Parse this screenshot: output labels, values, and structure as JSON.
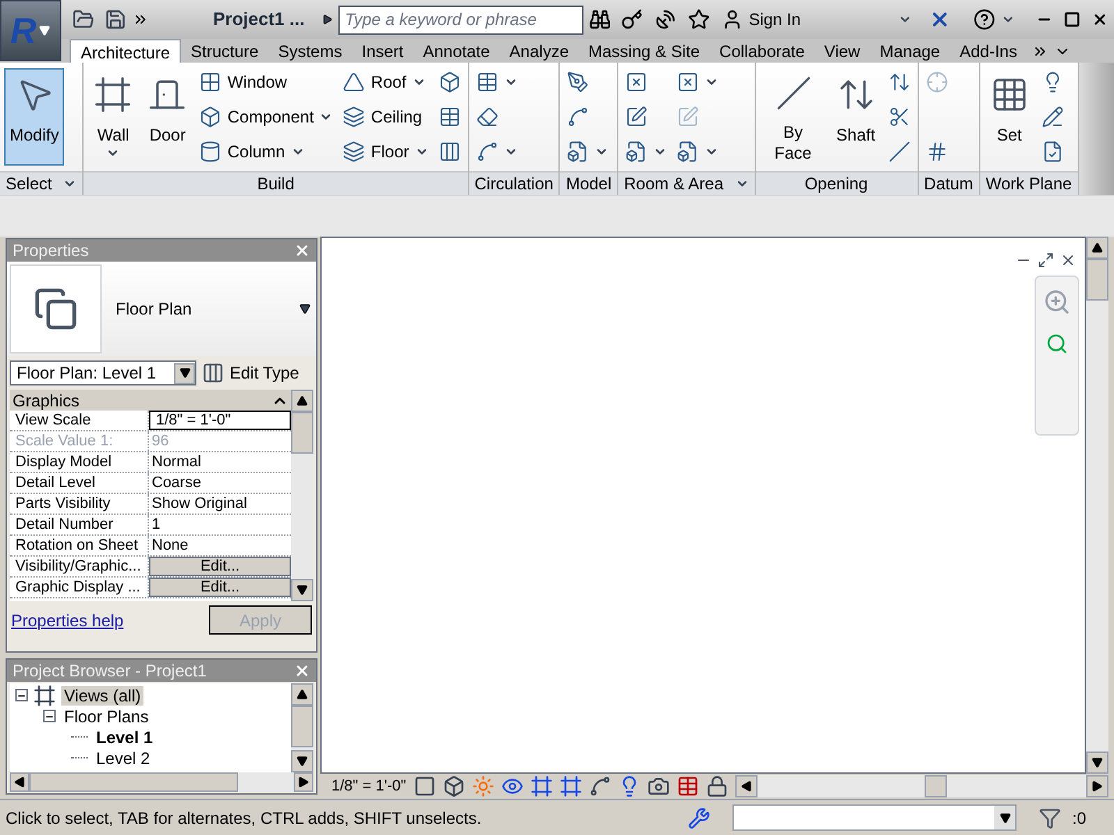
{
  "title_bar": {
    "logo_letter": "R",
    "project_title": "Project1 ...",
    "search": {
      "placeholder": "Type a keyword or phrase"
    },
    "sign_in": "Sign In"
  },
  "tabs": [
    {
      "label": "Architecture",
      "selected": true
    },
    {
      "label": "Structure",
      "selected": false
    },
    {
      "label": "Systems",
      "selected": false
    },
    {
      "label": "Insert",
      "selected": false
    },
    {
      "label": "Annotate",
      "selected": false
    },
    {
      "label": "Analyze",
      "selected": false
    },
    {
      "label": "Massing & Site",
      "selected": false
    },
    {
      "label": "Collaborate",
      "selected": false
    },
    {
      "label": "View",
      "selected": false
    },
    {
      "label": "Manage",
      "selected": false
    },
    {
      "label": "Add-Ins",
      "selected": false
    }
  ],
  "ribbon": [
    {
      "label": "Select",
      "menu": true,
      "columns": [
        {
          "kind": "large",
          "label": "Modify",
          "selected": true,
          "dropdown": false
        }
      ]
    },
    {
      "label": "Build",
      "menu": false,
      "columns": [
        {
          "kind": "large",
          "label": "Wall",
          "selected": false,
          "dropdown": true
        },
        {
          "kind": "large",
          "label": "Door",
          "selected": false,
          "dropdown": false
        },
        {
          "kind": "stack",
          "items": [
            {
              "label": "Window",
              "dropdown": false,
              "disabled": false
            },
            {
              "label": "Component",
              "dropdown": true,
              "disabled": false
            },
            {
              "label": "Column",
              "dropdown": true,
              "disabled": false
            }
          ]
        },
        {
          "kind": "stack",
          "items": [
            {
              "label": "Roof",
              "dropdown": true,
              "disabled": false
            },
            {
              "label": "Ceiling",
              "dropdown": false,
              "disabled": false
            },
            {
              "label": "Floor",
              "dropdown": true,
              "disabled": false
            }
          ]
        },
        {
          "kind": "stack",
          "items": [
            {
              "dropdown": false,
              "disabled": false
            },
            {
              "dropdown": false,
              "disabled": false
            },
            {
              "dropdown": false,
              "disabled": false
            }
          ]
        }
      ]
    },
    {
      "label": "Circulation",
      "menu": false,
      "columns": [
        {
          "kind": "stack",
          "items": [
            {
              "dropdown": true,
              "disabled": false
            },
            {
              "dropdown": false,
              "disabled": false
            },
            {
              "dropdown": true,
              "disabled": false
            }
          ]
        }
      ]
    },
    {
      "label": "Model",
      "menu": false,
      "columns": [
        {
          "kind": "stack",
          "items": [
            {
              "dropdown": false,
              "disabled": false
            },
            {
              "dropdown": false,
              "disabled": false
            },
            {
              "dropdown": true,
              "disabled": false
            }
          ]
        }
      ]
    },
    {
      "label": "Room & Area",
      "menu": true,
      "columns": [
        {
          "kind": "stack",
          "items": [
            {
              "dropdown": false,
              "disabled": false
            },
            {
              "dropdown": false,
              "disabled": false
            },
            {
              "dropdown": true,
              "disabled": false
            }
          ]
        },
        {
          "kind": "stack",
          "items": [
            {
              "dropdown": true,
              "disabled": false
            },
            {
              "dropdown": false,
              "disabled": true
            },
            {
              "dropdown": true,
              "disabled": false
            }
          ]
        }
      ]
    },
    {
      "label": "Opening",
      "menu": false,
      "columns": [
        {
          "kind": "large",
          "label": "By Face",
          "selected": false,
          "dropdown": false
        },
        {
          "kind": "large",
          "label": "Shaft",
          "selected": false,
          "dropdown": false
        },
        {
          "kind": "stack",
          "items": [
            {
              "dropdown": false,
              "disabled": false
            },
            {
              "dropdown": false,
              "disabled": false
            },
            {
              "dropdown": false,
              "disabled": false
            }
          ]
        }
      ]
    },
    {
      "label": "Datum",
      "menu": false,
      "columns": [
        {
          "kind": "stack",
          "items": [
            {
              "dropdown": false,
              "disabled": true
            },
            {
              "dropdown": false,
              "disabled": false
            }
          ]
        }
      ]
    },
    {
      "label": "Work Plane",
      "menu": false,
      "columns": [
        {
          "kind": "large",
          "label": "Set",
          "selected": false,
          "dropdown": false
        },
        {
          "kind": "stack",
          "items": [
            {
              "dropdown": false,
              "disabled": false
            },
            {
              "dropdown": false,
              "disabled": false
            },
            {
              "dropdown": false,
              "disabled": false
            }
          ]
        }
      ]
    }
  ],
  "properties": {
    "title": "Properties",
    "type_name": "Floor Plan",
    "instance": "Floor Plan: Level 1",
    "edit_type": "Edit Type",
    "group": "Graphics",
    "rows": [
      {
        "name": "View Scale",
        "value": "1/8\" = 1'-0\"",
        "kind": "input"
      },
      {
        "name": "Scale Value    1:",
        "value": "96",
        "kind": "disabled"
      },
      {
        "name": "Display Model",
        "value": "Normal",
        "kind": "text"
      },
      {
        "name": "Detail Level",
        "value": "Coarse",
        "kind": "text"
      },
      {
        "name": "Parts Visibility",
        "value": "Show Original",
        "kind": "text"
      },
      {
        "name": "Detail Number",
        "value": "1",
        "kind": "text"
      },
      {
        "name": "Rotation on Sheet",
        "value": "None",
        "kind": "text"
      },
      {
        "name": "Visibility/Graphic...",
        "value": "Edit...",
        "kind": "button"
      },
      {
        "name": "Graphic Display ...",
        "value": "Edit...",
        "kind": "button"
      }
    ],
    "help": "Properties help",
    "apply": {
      "label": "Apply",
      "disabled": true
    }
  },
  "project_browser": {
    "title": "Project Browser - Project1",
    "tree": [
      {
        "label": "Views (all)",
        "selected": true,
        "current": false,
        "expanded": true,
        "children": [
          {
            "label": "Floor Plans",
            "selected": false,
            "current": false,
            "expanded": true,
            "children": [
              {
                "label": "Level 1",
                "selected": false,
                "current": true
              },
              {
                "label": "Level 2",
                "selected": false,
                "current": false
              }
            ]
          }
        ]
      }
    ]
  },
  "view_bar": {
    "scale": "1/8\" = 1'-0\""
  },
  "status_bar": {
    "message": "Click to select, TAB for alternates, CTRL adds, SHIFT unselects.",
    "selection_count": ":0"
  }
}
